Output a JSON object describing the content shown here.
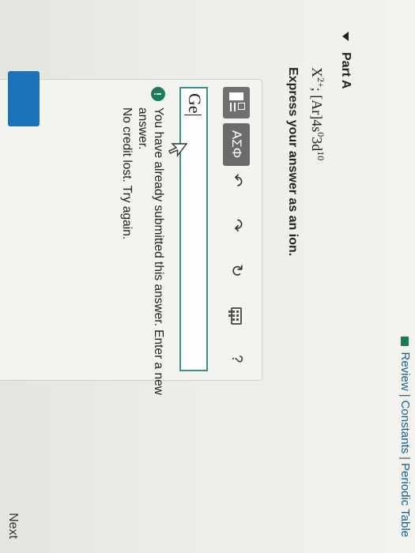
{
  "header": {
    "links": [
      "Review",
      "Constants",
      "Periodic Table"
    ],
    "separator": "|"
  },
  "part": {
    "title": "Part A"
  },
  "question": {
    "ion_base": "X",
    "ion_charge": "2+",
    "config_sep": ";",
    "core": "[Ar]",
    "orb1": "4s",
    "orb1_exp": "0",
    "orb2": "3d",
    "orb2_exp": "10",
    "prompt": "Express your answer as an ion."
  },
  "toolbar": {
    "greek_label": "ΑΣΦ",
    "undo_glyph": "↶",
    "redo_glyph": "↷",
    "reset_glyph": "↻",
    "help_label": "?"
  },
  "answer": {
    "value": "Ge"
  },
  "feedback": {
    "icon_glyph": "!",
    "line1": "You have already submitted this answer. Enter a new answer.",
    "line2": "No credit lost. Try again."
  },
  "footer": {
    "next_label": "Next"
  },
  "colors": {
    "accent_teal": "#3f8f87",
    "link_blue": "#1a5e8a",
    "submit_blue": "#1a72b8"
  },
  "icons": {
    "book": "book-icon",
    "caret": "caret-down-icon",
    "pointer": "mouse-pointer-icon",
    "keyboard": "keyboard-icon"
  }
}
